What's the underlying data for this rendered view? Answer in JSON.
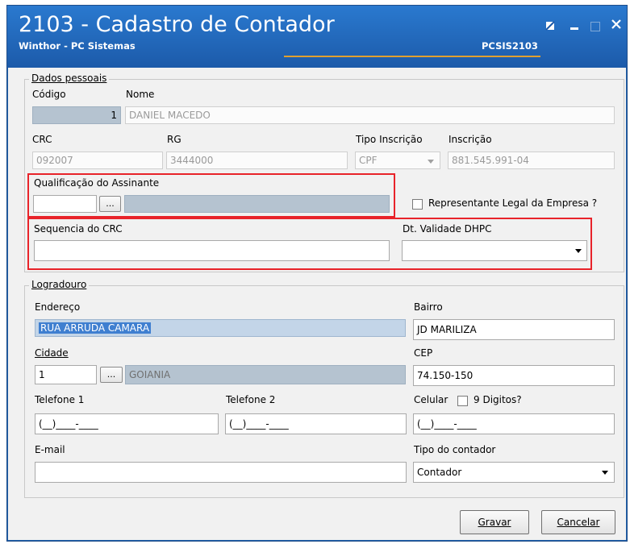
{
  "window": {
    "title": "2103 - Cadastro de Contador",
    "subtitle": "Winthor - PC Sistemas",
    "code": "PCSIS2103"
  },
  "dados_pessoais": {
    "legend": "Dados pessoais",
    "codigo_label": "Código",
    "codigo_value": "1",
    "nome_label": "Nome",
    "nome_value": "DANIEL MACEDO",
    "crc_label": "CRC",
    "crc_value": "092007",
    "rg_label": "RG",
    "rg_value": "3444000",
    "tipo_inscricao_label": "Tipo Inscrição",
    "tipo_inscricao_value": "CPF",
    "inscricao_label": "Inscrição",
    "inscricao_value": "881.545.991-04",
    "qualificacao_label": "Qualificação do Assinante",
    "qualificacao_code": "",
    "qualificacao_desc": "",
    "dots_label": "...",
    "representante_label": "Representante Legal da Empresa ?",
    "sequencia_crc_label": "Sequencia do CRC",
    "sequencia_crc_value": "",
    "dt_validade_label": "Dt. Validade DHPC",
    "dt_validade_value": ""
  },
  "logradouro": {
    "legend": "Logradouro",
    "endereco_label": "Endereço",
    "endereco_value": "RUA ARRUDA CAMARA",
    "bairro_label": "Bairro",
    "bairro_value": "JD MARILIZA",
    "cidade_label": "Cidade",
    "cidade_code": "1",
    "cidade_name": "GOIANIA",
    "cep_label": "CEP",
    "cep_value": "74.150-150",
    "telefone1_label": "Telefone 1",
    "telefone1_value": "(__)____-____",
    "telefone2_label": "Telefone 2",
    "telefone2_value": "(__)____-____",
    "celular_label": "Celular",
    "nove_digitos_label": "9 Digitos?",
    "celular_value": "(__)____-____",
    "email_label": "E-mail",
    "email_value": "",
    "tipo_contador_label": "Tipo do contador",
    "tipo_contador_value": "Contador"
  },
  "actions": {
    "gravar": "Gravar",
    "cancelar": "Cancelar"
  },
  "colors": {
    "titlebar": "#1f5fa8",
    "highlight_border": "#e8232a",
    "accent_line": "#e0a030"
  }
}
